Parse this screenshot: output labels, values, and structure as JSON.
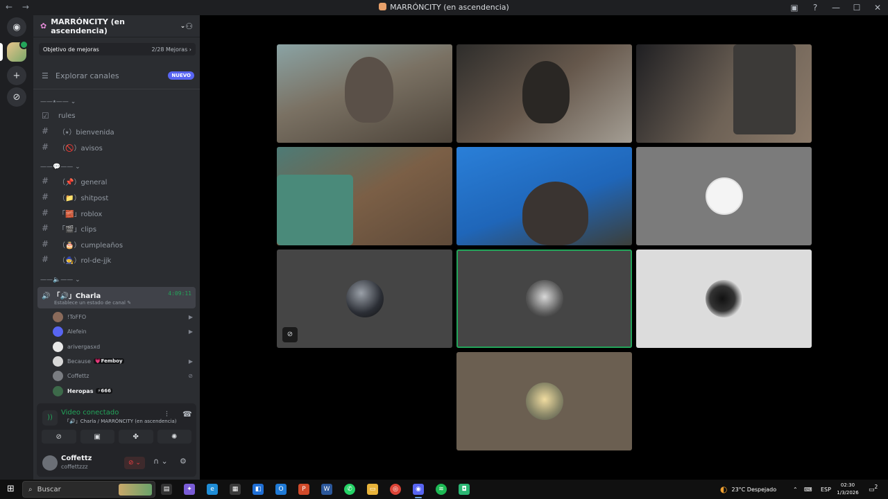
{
  "window": {
    "title": "MARRÓNCITY (en ascendencia)",
    "nav_back": "←",
    "nav_forward": "→",
    "controls": [
      "inbox-icon",
      "help-icon",
      "minimize",
      "maximize",
      "close"
    ]
  },
  "server": {
    "name": "MARRÓNCITY (en ascendencia)",
    "boost_label": "Objetivo de mejoras",
    "boost_count": "2/28 Mejoras ›",
    "explore_label": "Explorar canales",
    "explore_badge": "NUEVO"
  },
  "categories": [
    {
      "label": "——⭑——  ⌄"
    },
    {
      "label": "——💬——  ⌄"
    },
    {
      "label": "——🔈——  ⌄"
    }
  ],
  "channels": [
    {
      "icon": "rules-icon",
      "label": "rules"
    },
    {
      "icon": "hash-icon",
      "label": "（⭑）bienvenida"
    },
    {
      "icon": "hash-icon",
      "label": "（🚫）avisos"
    },
    {
      "icon": "hash-icon",
      "label": "（📌）general"
    },
    {
      "icon": "hash-icon",
      "label": "（📁）shitpost"
    },
    {
      "icon": "hash-icon",
      "label": "「🧱」roblox"
    },
    {
      "icon": "hash-icon",
      "label": "「🎬」clips"
    },
    {
      "icon": "hash-icon",
      "label": "（🎂）cumpleaños"
    },
    {
      "icon": "hash-icon",
      "label": "（🧙）rol-de-jjk"
    }
  ],
  "voice_channel": {
    "name": "「🔊」Charla",
    "timer": "4:09:11",
    "status": "Establece un estado de canal ✎"
  },
  "voice_users": [
    {
      "name": "!ToFFO",
      "indicator": "camera-icon",
      "tag": ""
    },
    {
      "name": "Alefein",
      "indicator": "camera-icon",
      "tag": ""
    },
    {
      "name": "arivergasxd",
      "indicator": "",
      "tag": ""
    },
    {
      "name": "Because",
      "indicator": "camera-icon",
      "tag": "💗Femboy"
    },
    {
      "name": "Coffettz",
      "indicator": "mic-off-icon",
      "tag": ""
    },
    {
      "name": "Heropas",
      "indicator": "",
      "tag": "⚡666"
    }
  ],
  "rtc": {
    "status": "Video conectado",
    "location": "「🔊」Charla / MARRÓNCITY (en ascendencia)"
  },
  "user": {
    "name": "Coffettz",
    "tag": "coffettzzz"
  },
  "taskbar": {
    "search_placeholder": "Buscar",
    "weather": "23°C  Despejado",
    "lang": "ESP",
    "time": "02:30",
    "date": "1/3/2026",
    "notifications": "2"
  },
  "colors": {
    "accent_green": "#23a55a",
    "blurple": "#5865f2",
    "danger": "#f23f43"
  }
}
